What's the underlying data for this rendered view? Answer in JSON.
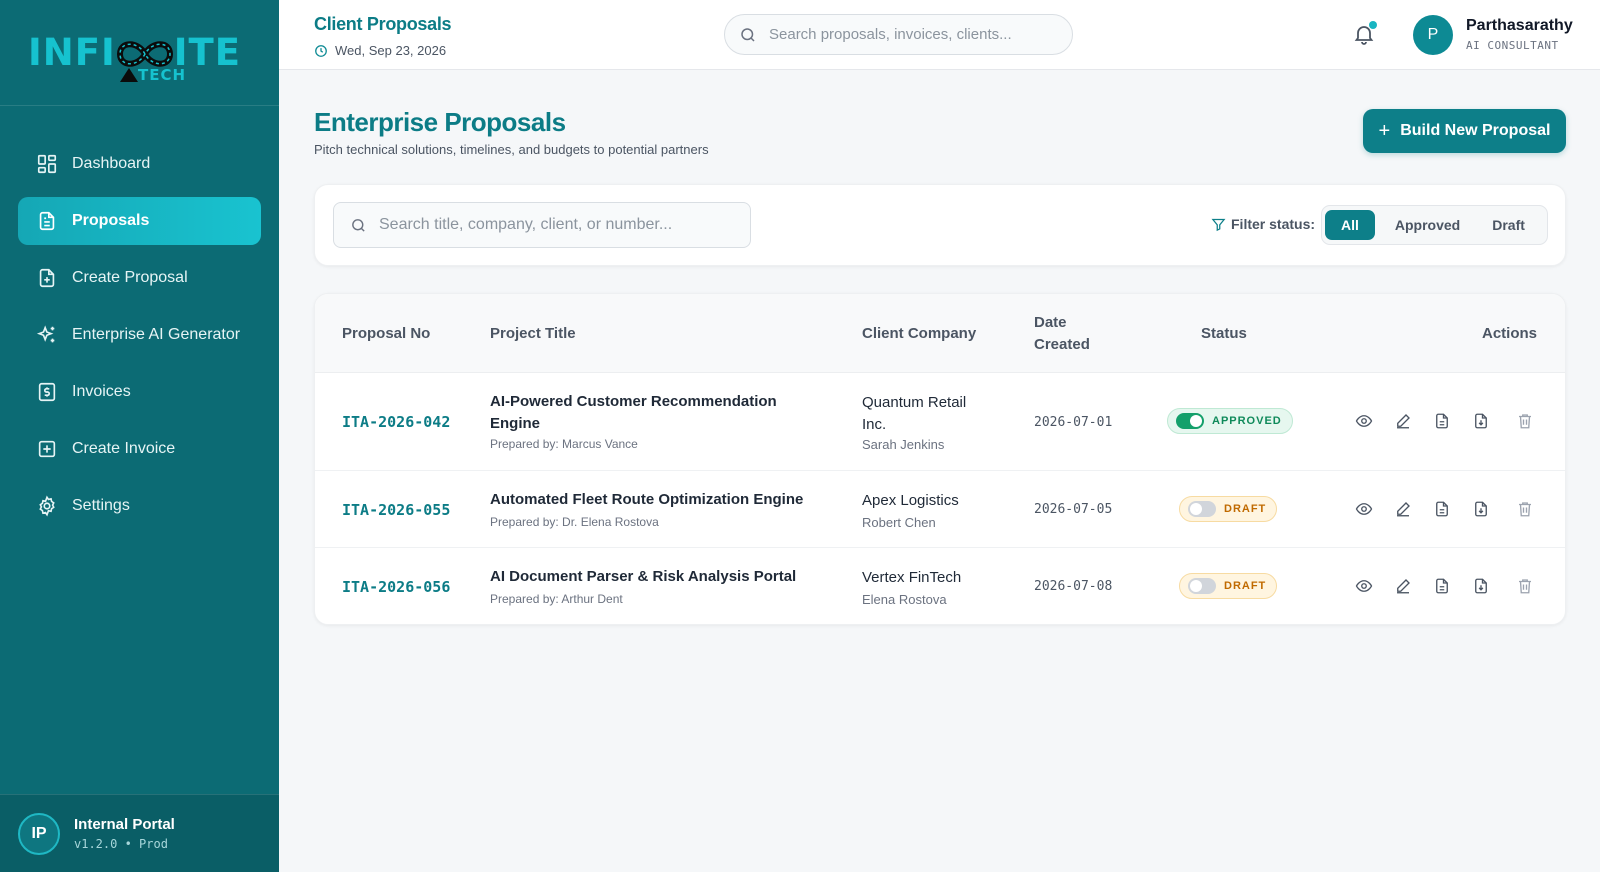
{
  "brand": {
    "logo_left": "INFI",
    "logo_right": "ITE",
    "logo_sub": "TECH"
  },
  "sidebar": {
    "items": [
      {
        "label": "Dashboard",
        "icon": "dashboard-grid-icon"
      },
      {
        "label": "Proposals",
        "icon": "document-icon",
        "active": true
      },
      {
        "label": "Create Proposal",
        "icon": "file-plus-icon"
      },
      {
        "label": "Enterprise AI Generator",
        "icon": "sparkles-icon"
      },
      {
        "label": "Invoices",
        "icon": "invoice-dollar-icon"
      },
      {
        "label": "Create Invoice",
        "icon": "square-plus-icon"
      },
      {
        "label": "Settings",
        "icon": "gear-icon"
      }
    ],
    "footer": {
      "initials": "IP",
      "title": "Internal Portal",
      "version": "v1.2.0 • Prod"
    }
  },
  "header": {
    "title": "Client Proposals",
    "date": "Wed, Sep 23, 2026",
    "search_placeholder": "Search proposals, invoices, clients...",
    "user": {
      "initial": "P",
      "name": "Parthasarathy",
      "role": "AI CONSULTANT"
    }
  },
  "main": {
    "title": "Enterprise Proposals",
    "subtitle": "Pitch technical solutions, timelines, and budgets to potential partners",
    "build_button": "Build New Proposal",
    "filter": {
      "search_placeholder": "Search title, company, client, or number...",
      "label": "Filter status:",
      "options": [
        "All",
        "Approved",
        "Draft"
      ],
      "selected": "All"
    },
    "table": {
      "columns": {
        "proposal_no": "Proposal No",
        "project_title": "Project Title",
        "client_company": "Client Company",
        "date_created_1": "Date",
        "date_created_2": "Created",
        "status": "Status",
        "actions": "Actions"
      },
      "rows": [
        {
          "number": "ITA-2026-042",
          "title": "AI-Powered Customer Recommendation Engine",
          "prepared_by": "Prepared by: Marcus Vance",
          "company": "Quantum Retail Inc.",
          "client": "Sarah Jenkins",
          "date": "2026-07-01",
          "status": "APPROVED"
        },
        {
          "number": "ITA-2026-055",
          "title": "Automated Fleet Route Optimization Engine",
          "prepared_by": "Prepared by: Dr. Elena Rostova",
          "company": "Apex Logistics",
          "client": "Robert Chen",
          "date": "2026-07-05",
          "status": "DRAFT"
        },
        {
          "number": "ITA-2026-056",
          "title": "AI Document Parser & Risk Analysis Portal",
          "prepared_by": "Prepared by: Arthur Dent",
          "company": "Vertex FinTech",
          "client": "Elena Rostova",
          "date": "2026-07-08",
          "status": "DRAFT"
        }
      ]
    }
  },
  "colors": {
    "primary": "#0d7f89",
    "sidebar": "#0c6b74",
    "accent": "#19c3d0",
    "approved": "#0f8a5a",
    "draft": "#c06a00"
  }
}
